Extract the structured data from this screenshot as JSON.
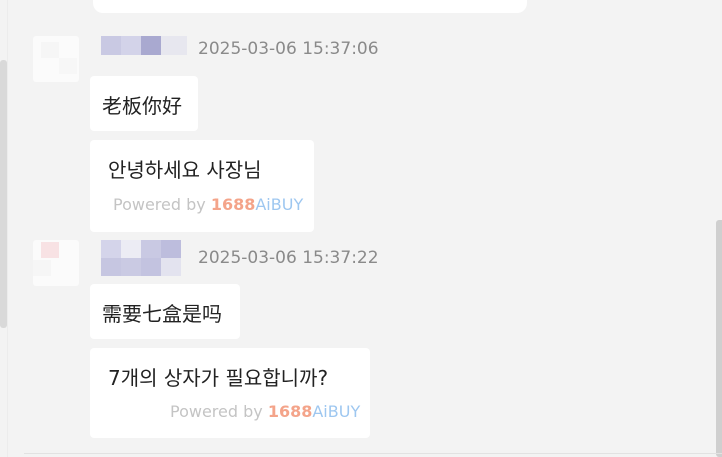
{
  "messages": [
    {
      "timestamp": "2025-03-06 15:37:06",
      "original": "老板你好",
      "translation": "안녕하세요 사장님",
      "powered_prefix": "Powered by",
      "brand_number": "1688",
      "brand_name": "AiBUY"
    },
    {
      "timestamp": "2025-03-06 15:37:22",
      "original": "需要七盒是吗",
      "translation": "7개의 상자가 필요합니까?",
      "powered_prefix": "Powered by",
      "brand_number": "1688",
      "brand_name": "AiBUY"
    }
  ],
  "colors": {
    "background": "#f3f3f3",
    "bubble": "#ffffff",
    "brand_number": "#f4a48a",
    "brand_name": "#9ec7f0",
    "timestamp": "#8a8a8a"
  }
}
